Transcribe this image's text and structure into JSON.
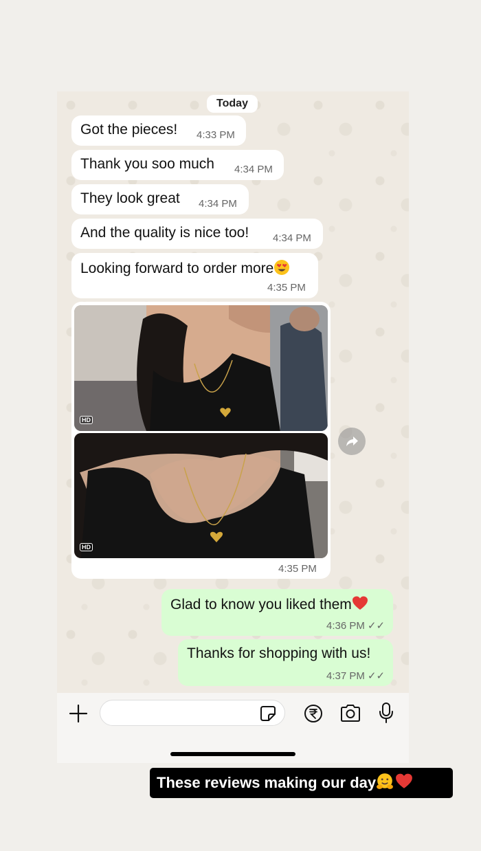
{
  "chat": {
    "date_label": "Today",
    "incoming": [
      {
        "text": "Got the pieces!",
        "time": "4:33 PM"
      },
      {
        "text": "Thank you soo much",
        "time": "4:34 PM"
      },
      {
        "text": "They look great",
        "time": "4:34 PM"
      },
      {
        "text": "And the quality is nice too!",
        "time": "4:34 PM"
      },
      {
        "text": "Looking forward to order more",
        "emoji": "heart-eyes-emoji",
        "time": "4:35 PM"
      }
    ],
    "media": {
      "photo_badges": [
        "HD",
        "HD"
      ],
      "time": "4:35 PM"
    },
    "outgoing": [
      {
        "text": "Glad to know you liked them",
        "emoji": "red-heart-emoji",
        "time": "4:36 PM",
        "status": "read-ticks"
      },
      {
        "text": "Thanks for shopping with us!",
        "time": "4:37 PM",
        "status": "read-ticks"
      }
    ]
  },
  "input_bar": {
    "icons": [
      "plus-icon",
      "sticker-icon",
      "rupee-payment-icon",
      "camera-icon",
      "microphone-icon"
    ]
  },
  "caption": {
    "text": "These reviews making our day",
    "emojis": [
      "hugging-face-emoji",
      "red-heart-emoji"
    ]
  },
  "colors": {
    "outgoing_bubble": "#d9fdd3",
    "incoming_bubble": "#ffffff",
    "wallpaper": "#efeae2"
  }
}
